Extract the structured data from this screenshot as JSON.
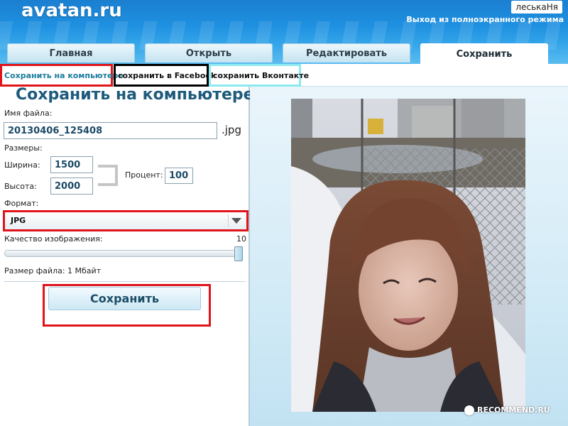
{
  "header": {
    "logo": "avatan.ru",
    "user_name": "леськаНя",
    "exit_fullscreen": "Выход из полноэкранного режима"
  },
  "tabs": [
    {
      "label": "Главная"
    },
    {
      "label": "Открыть"
    },
    {
      "label": "Редактировать"
    },
    {
      "label": "Сохранить",
      "active": true
    }
  ],
  "subtabs": [
    {
      "label": "Сохранить на компьютере"
    },
    {
      "label": "сохранить в Facebook"
    },
    {
      "label": "сохранить Вконтакте"
    }
  ],
  "save_form": {
    "title": "Сохранить на компьютере",
    "filename_label": "Имя файла:",
    "filename_value": "20130406_125408",
    "filename_ext": ".jpg",
    "sizes_label": "Размеры:",
    "width_label": "Ширина:",
    "width_value": "1500",
    "height_label": "Высота:",
    "height_value": "2000",
    "percent_label": "Процент:",
    "percent_value": "100",
    "format_label": "Формат:",
    "format_value": "JPG",
    "quality_label": "Качество изображения:",
    "quality_value": "10",
    "quality_fraction": 1.0,
    "filesize_text": "Размер файла: 1 Мбайт",
    "save_button": "Сохранить"
  },
  "watermark": "RECOMMEND.RU",
  "colors": {
    "header_blue": "#1e90e0",
    "highlight_red": "#e0141a",
    "highlight_black": "#000000",
    "highlight_cyan": "#8de9f0",
    "title_blue": "#1d5a7c"
  }
}
